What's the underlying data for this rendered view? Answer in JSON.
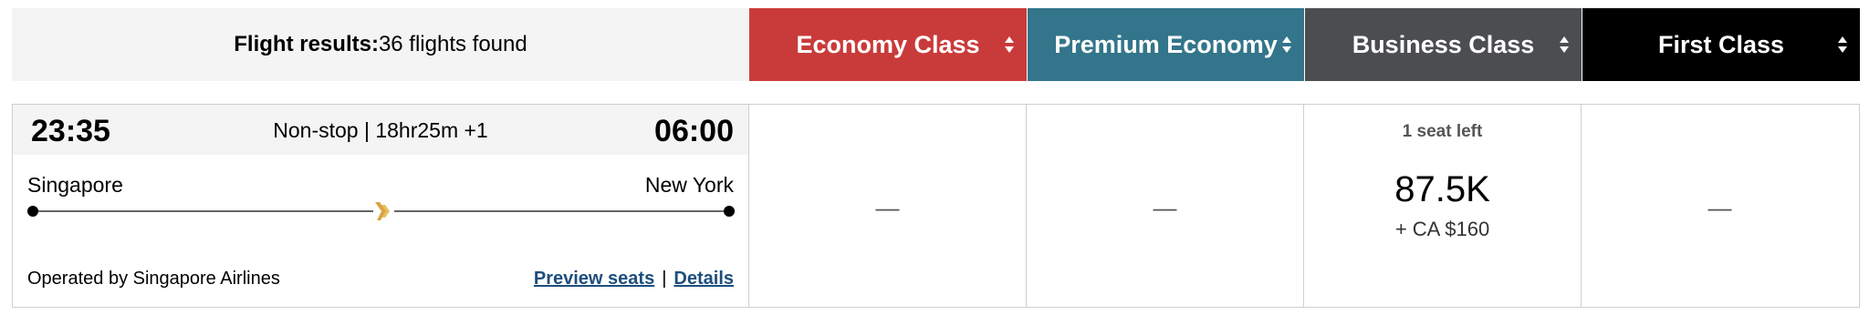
{
  "summary": {
    "label": "Flight results:",
    "count_text": "36 flights found"
  },
  "cabin_classes": [
    {
      "label": "Economy Class",
      "color": "#c93b3a"
    },
    {
      "label": "Premium Economy",
      "color": "#33758a"
    },
    {
      "label": "Business Class",
      "color": "#4b4d51"
    },
    {
      "label": "First Class",
      "color": "#000000"
    }
  ],
  "flight": {
    "departure_time": "23:35",
    "arrival_time": "06:00",
    "info": "Non-stop | 18hr25m +1",
    "origin": "Singapore",
    "destination": "New York",
    "operator": "Operated by Singapore Airlines",
    "preview_seats_label": "Preview seats",
    "separator": "|",
    "details_label": "Details",
    "airline_logo": "singapore-airlines-bird-icon"
  },
  "fares": {
    "economy": {
      "display": "—"
    },
    "premium": {
      "display": "—"
    },
    "business": {
      "seats_left": "1 seat left",
      "miles": "87.5K",
      "tax": "+ CA $160"
    },
    "first": {
      "display": "—"
    }
  }
}
